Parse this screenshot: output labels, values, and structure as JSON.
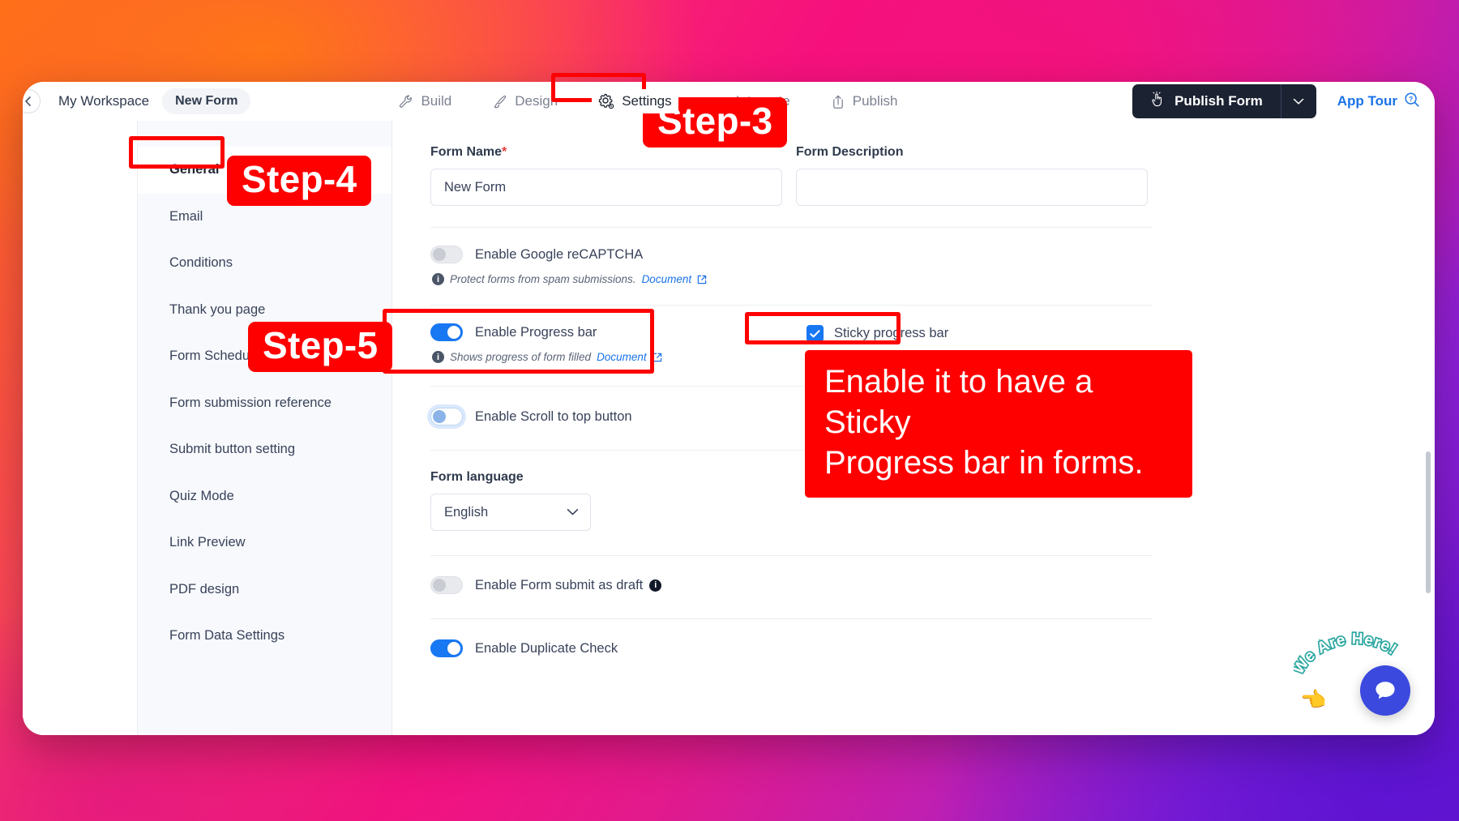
{
  "topbar": {
    "back_icon": "back-arrow-icon",
    "workspace": "My Workspace",
    "form_chip": "New Form",
    "tabs": [
      {
        "label": "Build",
        "icon": "wrench-icon",
        "active": false
      },
      {
        "label": "Design",
        "icon": "paintbrush-icon",
        "active": false
      },
      {
        "label": "Settings",
        "icon": "gear-icon",
        "active": true
      },
      {
        "label": "Integrate",
        "icon": "integration-icon",
        "active": false
      },
      {
        "label": "Publish",
        "icon": "upload-icon",
        "active": false
      }
    ],
    "publish_form_label": "Publish Form",
    "publish_form_icon": "click-hand-icon",
    "publish_caret_icon": "chevron-down-icon",
    "app_tour_label": "App Tour",
    "app_tour_icon": "help-search-icon"
  },
  "sidebar": {
    "items": [
      {
        "label": "General",
        "active": true
      },
      {
        "label": "Email",
        "active": false
      },
      {
        "label": "Conditions",
        "active": false
      },
      {
        "label": "Thank you page",
        "active": false
      },
      {
        "label": "Form Scheduling Settings",
        "active": false
      },
      {
        "label": "Form submission reference",
        "active": false
      },
      {
        "label": "Submit button setting",
        "active": false
      },
      {
        "label": "Quiz Mode",
        "active": false
      },
      {
        "label": "Link Preview",
        "active": false
      },
      {
        "label": "PDF design",
        "active": false
      },
      {
        "label": "Form Data Settings",
        "active": false
      }
    ]
  },
  "settings": {
    "form_name_label": "Form Name",
    "form_name_required": "*",
    "form_name_value": "New Form",
    "form_description_label": "Form Description",
    "form_description_value": "",
    "recaptcha": {
      "label": "Enable Google reCAPTCHA",
      "enabled": false,
      "help": "Protect forms from spam submissions.",
      "doc_link": "Document"
    },
    "progress_bar": {
      "label": "Enable Progress bar",
      "enabled": true,
      "help": "Shows progress of form filled",
      "doc_link": "Document"
    },
    "sticky_progress_bar": {
      "label": "Sticky progress bar",
      "checked": true
    },
    "scroll_top": {
      "label": "Enable Scroll to top button",
      "enabled": false
    },
    "form_language": {
      "label": "Form language",
      "value": "English"
    },
    "submit_as_draft": {
      "label": "Enable Form submit as draft",
      "enabled": false
    },
    "duplicate_check": {
      "label": "Enable Duplicate Check",
      "enabled": true
    }
  },
  "annotations": {
    "step3": "Step-3",
    "step4": "Step-4",
    "step5": "Step-5",
    "callout_line1": "Enable it to have a Sticky",
    "callout_line2": "Progress bar in forms.",
    "highlight_color": "#ff0000"
  },
  "chat_widget": {
    "text": "We Are Here!",
    "icon": "chat-bubble-icon",
    "hand_icon": "pointing-hand-icon",
    "color": "#3b49df"
  }
}
